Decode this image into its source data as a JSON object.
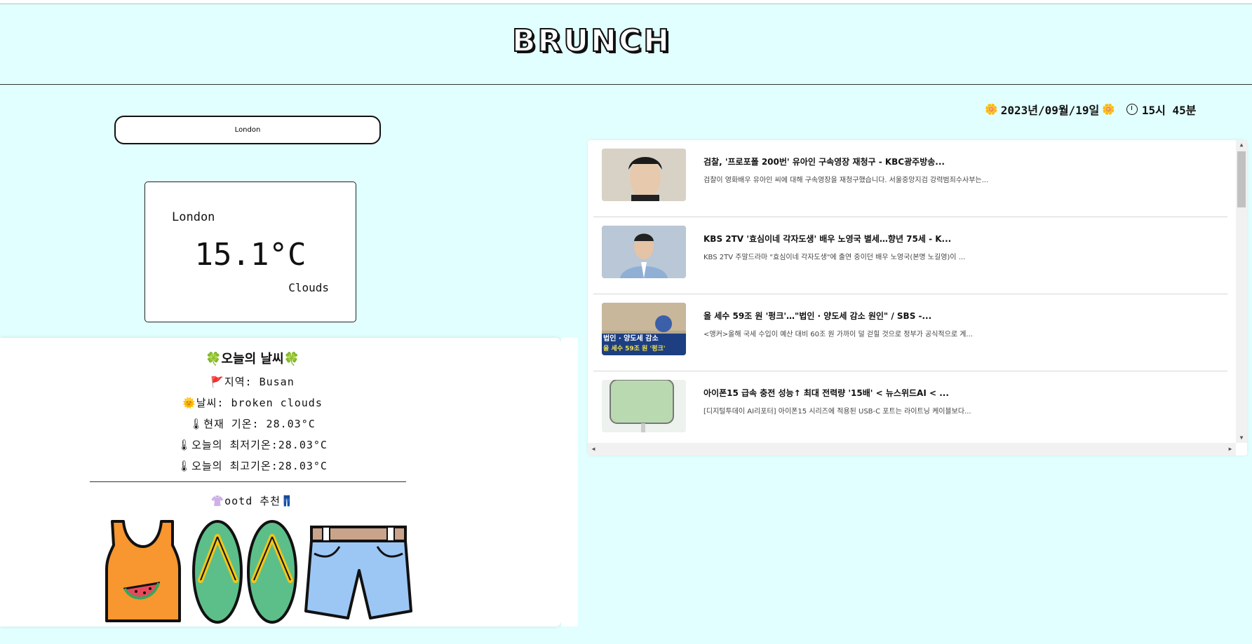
{
  "app": {
    "logo": "BRUNCH"
  },
  "search": {
    "value": "London",
    "placeholder": ""
  },
  "weather_card": {
    "city": "London",
    "temp": "15.1°C",
    "condition": "Clouds"
  },
  "datetime": {
    "date": "2023년/09월/19일",
    "time": "15시 45분",
    "flower": "🌼"
  },
  "today": {
    "title": "🍀오늘의 날씨🍀",
    "region": "🚩지역: Busan",
    "weather": "🌞날씨: broken clouds",
    "current_temp": "🌡현재 기온: 28.03°C",
    "min_temp": "🌡오늘의 최저기온:28.03°C",
    "max_temp": "🌡오늘의 최고기온:28.03°C",
    "ootd_title": "👚ootd 추천👖"
  },
  "clothes": [
    "tank-top-icon",
    "flip-flops-icon",
    "shorts-icon"
  ],
  "news": [
    {
      "title": "검찰, '프로포폴 200번' 유아인 구속영장 재청구 - KBC광주방송...",
      "desc": "검찰이 영화배우 유아인 씨에 대해 구속영장을 재청구했습니다. 서울중앙지검 강력범죄수사부는...",
      "thumb_color": "#c9c1b4"
    },
    {
      "title": "KBS 2TV '효심이네 각자도생' 배우 노영국 별세…향년 75세 - K...",
      "desc": "KBS 2TV 주말드라마 \"효심이네 각자도생\"에 출연 중이던 배우 노영국(본명 노길영)이 ...",
      "thumb_color": "#9fb5cf"
    },
    {
      "title": "올 세수 59조 원 '펑크'…\"법인 · 양도세 감소 원인\" / SBS -...",
      "desc": "<앵커>올해 국세 수입이 예산 대비 60조 원 가까이 덜 걷힐 것으로 정부가 공식적으로 계...",
      "thumb_color": "#2b4f8a",
      "thumb_text1": "법인 · 양도세 감소",
      "thumb_text2": "올 세수 59조 원 '펑크'"
    },
    {
      "title": "아이폰15 급속 충전 성능↑ 최대 전력량 '15배' < 뉴스위드AI < ...",
      "desc": "[디지털투데이 AI리포터] 아이폰15 시리즈에 적용된 USB-C 포트는 라이트닝 케이블보다...",
      "thumb_color": "#dfe9dd"
    }
  ]
}
